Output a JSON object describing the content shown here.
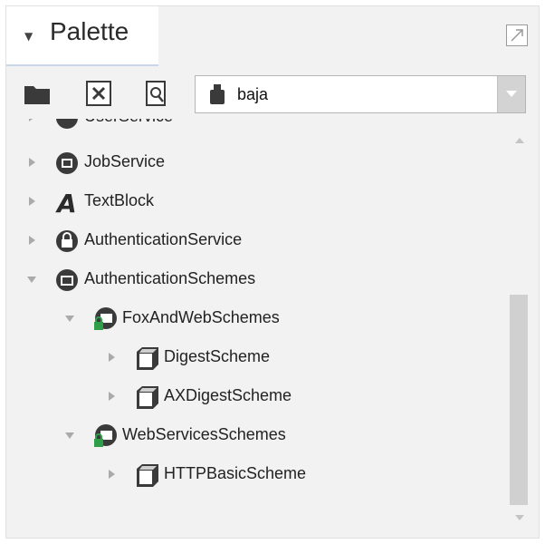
{
  "header": {
    "title": "Palette"
  },
  "toolbar": {
    "selected_palette": "baja"
  },
  "tree": {
    "items": [
      {
        "label": "UserService",
        "state": "collapsed",
        "icon": "user-service-icon",
        "partial": true
      },
      {
        "label": "JobService",
        "state": "collapsed",
        "icon": "job-service-icon"
      },
      {
        "label": "TextBlock",
        "state": "collapsed",
        "icon": "text-block-icon"
      },
      {
        "label": "AuthenticationService",
        "state": "collapsed",
        "icon": "lock-icon"
      },
      {
        "label": "AuthenticationSchemes",
        "state": "expanded",
        "icon": "folder-icon"
      },
      {
        "label": "FoxAndWebSchemes",
        "state": "expanded",
        "icon": "secure-folder-icon"
      },
      {
        "label": "DigestScheme",
        "state": "collapsed",
        "icon": "component-icon"
      },
      {
        "label": "AXDigestScheme",
        "state": "collapsed",
        "icon": "component-icon"
      },
      {
        "label": "WebServicesSchemes",
        "state": "expanded",
        "icon": "secure-folder-icon"
      },
      {
        "label": "HTTPBasicScheme",
        "state": "collapsed",
        "icon": "component-icon"
      }
    ]
  }
}
